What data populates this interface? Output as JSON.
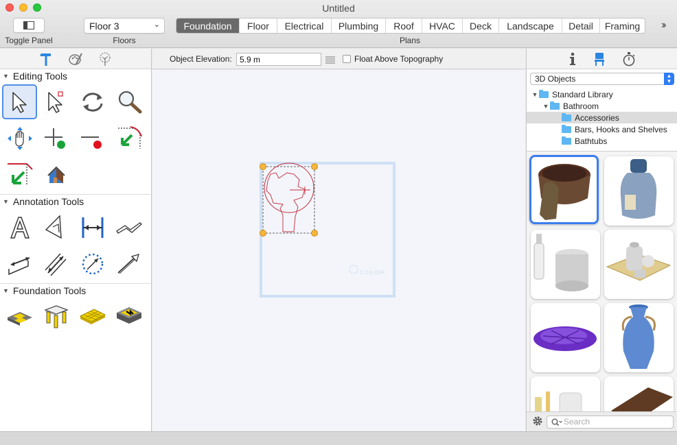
{
  "window": {
    "title": "Untitled"
  },
  "toolbar": {
    "toggle_panel_label": "Toggle Panel",
    "floors_label": "Floors",
    "floor_value": "Floor 3",
    "plans_label": "Plans",
    "plans": [
      {
        "label": "Foundation",
        "active": true
      },
      {
        "label": "Floor",
        "active": false
      },
      {
        "label": "Electrical",
        "active": false
      },
      {
        "label": "Plumbing",
        "active": false
      },
      {
        "label": "Roof",
        "active": false
      },
      {
        "label": "HVAC",
        "active": false
      },
      {
        "label": "Deck",
        "active": false
      },
      {
        "label": "Landscape",
        "active": false
      },
      {
        "label": "Detail",
        "active": false
      },
      {
        "label": "Framing",
        "active": false
      }
    ]
  },
  "left_panel": {
    "sections": [
      {
        "title": "Editing Tools",
        "tools": [
          "select-arrow-icon",
          "select-point-icon",
          "rotate-icon",
          "zoom-icon",
          "pan-hand-icon",
          "add-point-icon",
          "remove-point-icon",
          "join-corner-icon",
          "join-walls-icon",
          "house-icon"
        ]
      },
      {
        "title": "Annotation Tools",
        "tools": [
          "text-icon",
          "text-3d-icon",
          "dimension-icon",
          "break-line-icon",
          "angle-dimension-icon",
          "diagonal-dimension-icon",
          "circle-dimension-icon",
          "arrow-icon"
        ]
      },
      {
        "title": "Foundation Tools",
        "tools": [
          "footing-icon",
          "pier-icon",
          "slab-icon",
          "foundation-wall-icon"
        ]
      }
    ]
  },
  "center": {
    "elevation_label": "Object Elevation:",
    "elevation_value": "5.9 m",
    "float_label": "Float Above Topography",
    "float_checked": false,
    "canvas_annotation": "0.3 m DIA"
  },
  "right_panel": {
    "library_select": "3D Objects",
    "tree": [
      {
        "label": "Standard Library",
        "level": 0,
        "expanded": true,
        "selected": false
      },
      {
        "label": "Bathroom",
        "level": 1,
        "expanded": true,
        "selected": false
      },
      {
        "label": "Accessories",
        "level": 2,
        "expanded": false,
        "selected": true
      },
      {
        "label": "Bars, Hooks and Shelves",
        "level": 2,
        "expanded": false,
        "selected": false
      },
      {
        "label": "Bathtubs",
        "level": 2,
        "expanded": false,
        "selected": false
      }
    ],
    "search_placeholder": "Search"
  },
  "colors": {
    "accent": "#3b7ded",
    "selection_blue": "#4f8ee8",
    "handle": "#f4b73d",
    "sketch_red": "#c22b3b",
    "foundation_outline": "#cfe0f5"
  }
}
